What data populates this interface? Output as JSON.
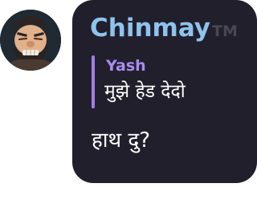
{
  "avatar": {
    "icon": "grimacing-bearded-man-avatar-icon"
  },
  "message": {
    "sender_name": "Chinmay",
    "sender_tag": "TM",
    "reply": {
      "author": "Yash",
      "text": "मुझे हेड देदो"
    },
    "body": "हाथ दु?"
  },
  "colors": {
    "bubble_bg": "#221f2d",
    "sender_name": "#8ec3ec",
    "sender_tag": "#4a4752",
    "reply_bar": "#9f7fe6",
    "reply_author": "#a98cf0",
    "text": "#ffffff"
  }
}
